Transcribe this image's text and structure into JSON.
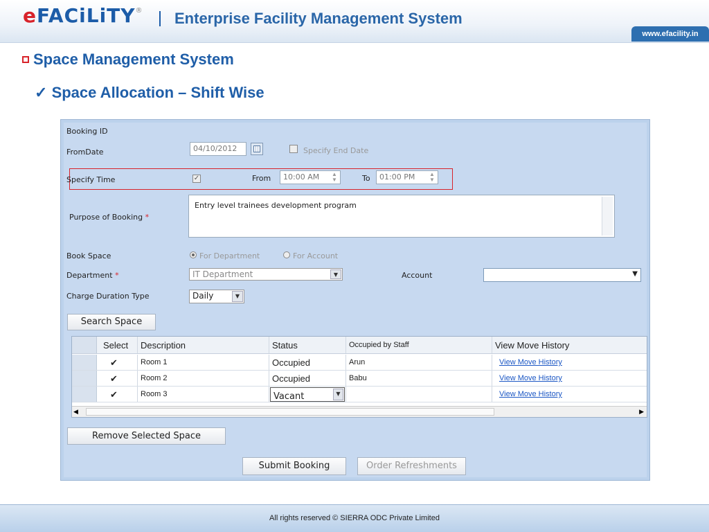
{
  "header": {
    "logo_e": "e",
    "logo_rest": "FACiLiTY",
    "logo_mark": "®",
    "title": "Enterprise Facility Management System",
    "url": "www.efacility.in"
  },
  "section": {
    "title": "Space Management System",
    "subtitle": "Space Allocation – Shift Wise",
    "check_icon": "✓"
  },
  "form": {
    "booking_id_label": "Booking ID",
    "from_date_label": "FromDate",
    "from_date_value": "04/10/2012",
    "specify_end_date_label": "Specify End Date",
    "specify_time_label": "Specify Time",
    "from_label": "From",
    "from_time": "10:00 AM",
    "to_label": "To",
    "to_time": "01:00 PM",
    "purpose_label": "Purpose of Booking",
    "purpose_value": "Entry level trainees development program",
    "book_space_label": "Book Space",
    "for_department": "For Department",
    "for_account": "For Account",
    "department_label": "Department",
    "department_value": "IT Department",
    "account_label": "Account",
    "account_value": "",
    "charge_label": "Charge Duration Type",
    "charge_value": "Daily",
    "required_mark": "*",
    "search_button": "Search Space"
  },
  "table": {
    "headers": [
      "Select",
      "Description",
      "Status",
      "Occupied by Staff",
      "View Move History"
    ],
    "rows": [
      {
        "checked": "✔",
        "description": "Room 1",
        "status": "Occupied",
        "staff": "Arun",
        "link": "View Move History"
      },
      {
        "checked": "✔",
        "description": "Room 2",
        "status": "Occupied",
        "staff": "Babu",
        "link": "View Move History"
      },
      {
        "checked": "✔",
        "description": "Room 3",
        "status": "Vacant",
        "staff": "",
        "link": "View Move History"
      }
    ]
  },
  "actions": {
    "remove": "Remove Selected Space",
    "submit": "Submit Booking",
    "refresh": "Order Refreshments"
  },
  "footer": {
    "text": "All rights reserved © SIERRA ODC Private Limited"
  },
  "colors": {
    "brand_blue": "#1f5ea8",
    "brand_red": "#d8232a",
    "panel": "#c7d9f0"
  }
}
